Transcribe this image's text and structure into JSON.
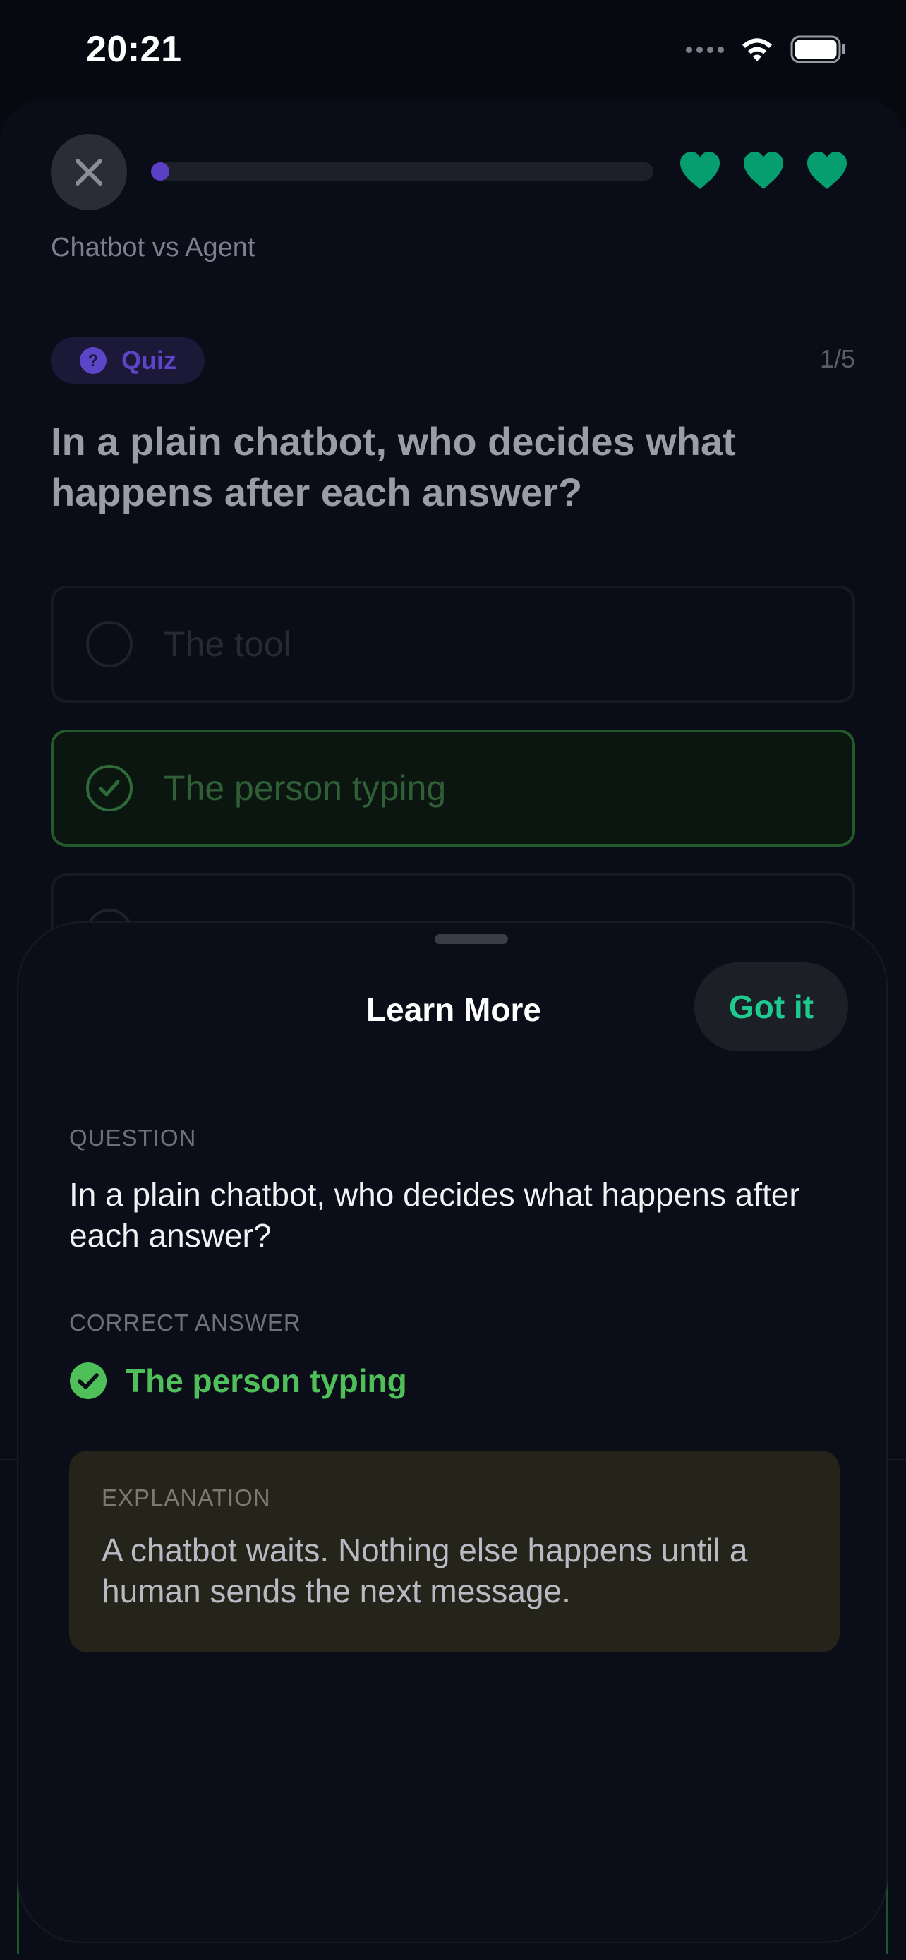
{
  "status_bar": {
    "time": "20:21"
  },
  "lesson": {
    "title": "Chatbot vs Agent",
    "progress": 0.03,
    "hearts": 3
  },
  "quiz": {
    "badge_label": "Quiz",
    "counter": "1/5",
    "question": "In a plain chatbot, who decides what happens after each answer?",
    "options": [
      {
        "label": "The tool",
        "state": "dim"
      },
      {
        "label": "The person typing",
        "state": "correct"
      },
      {
        "label": "",
        "state": "dim"
      }
    ]
  },
  "sheet": {
    "title": "Learn More",
    "got_it_label": "Got it",
    "question_label": "QUESTION",
    "question_text": "In a plain chatbot, who decides what happens after each answer?",
    "correct_label": "CORRECT ANSWER",
    "correct_answer": "The person typing",
    "explanation_label": "EXPLANATION",
    "explanation_text": "A chatbot waits. Nothing else happens until a human sends the next message."
  },
  "colors": {
    "accent_purple": "#5b3fc4",
    "heart_green": "#069e6e",
    "correct_green": "#4fbf5a",
    "got_it_green": "#1ecb8f",
    "explanation_bg": "#24241b"
  }
}
